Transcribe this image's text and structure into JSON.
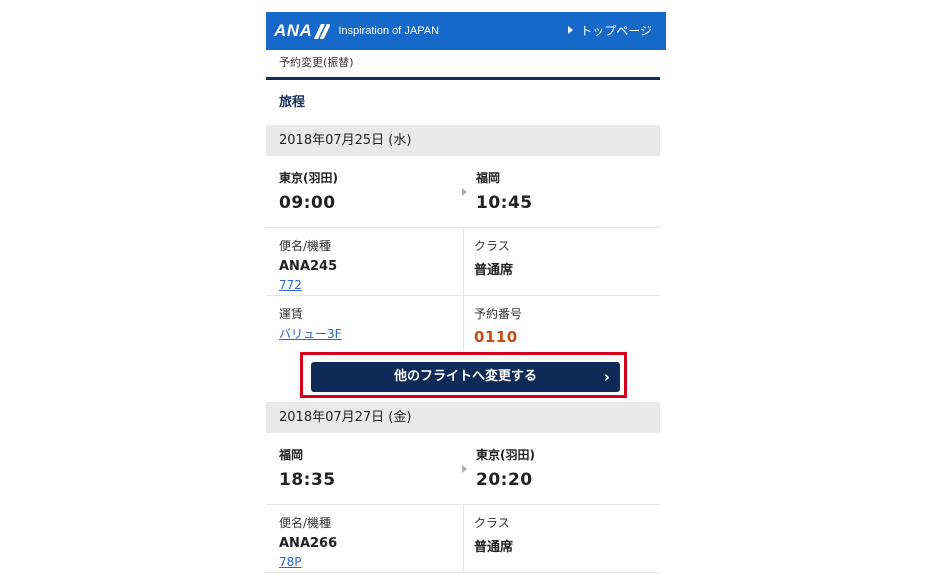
{
  "header": {
    "logo": "ANA",
    "tagline": "Inspiration of JAPAN",
    "top_link": "トップページ"
  },
  "breadcrumb": "予約変更(振替)",
  "section_title": "旅程",
  "flights": [
    {
      "date": "2018年07月25日 (水)",
      "from_city": "東京(羽田)",
      "from_time": "09:00",
      "to_city": "福岡",
      "to_time": "10:45",
      "flight_label": "便名/機種",
      "flight_no": "ANA245",
      "aircraft": "772",
      "class_label": "クラス",
      "class_value": "普通席",
      "fare_label": "運賃",
      "fare_value": "バリュー3F",
      "reservation_label": "予約番号",
      "reservation_no": "0110"
    },
    {
      "date": "2018年07月27日 (金)",
      "from_city": "福岡",
      "from_time": "18:35",
      "to_city": "東京(羽田)",
      "to_time": "20:20",
      "flight_label": "便名/機種",
      "flight_no": "ANA266",
      "aircraft": "78P",
      "class_label": "クラス",
      "class_value": "普通席"
    }
  ],
  "change_button": "他のフライトへ変更する",
  "colors": {
    "header_bg": "#1669c9",
    "navy": "#0e2a57",
    "highlight_border": "#d6001c",
    "reservation_number": "#c64d10",
    "link": "#2b64c4"
  }
}
